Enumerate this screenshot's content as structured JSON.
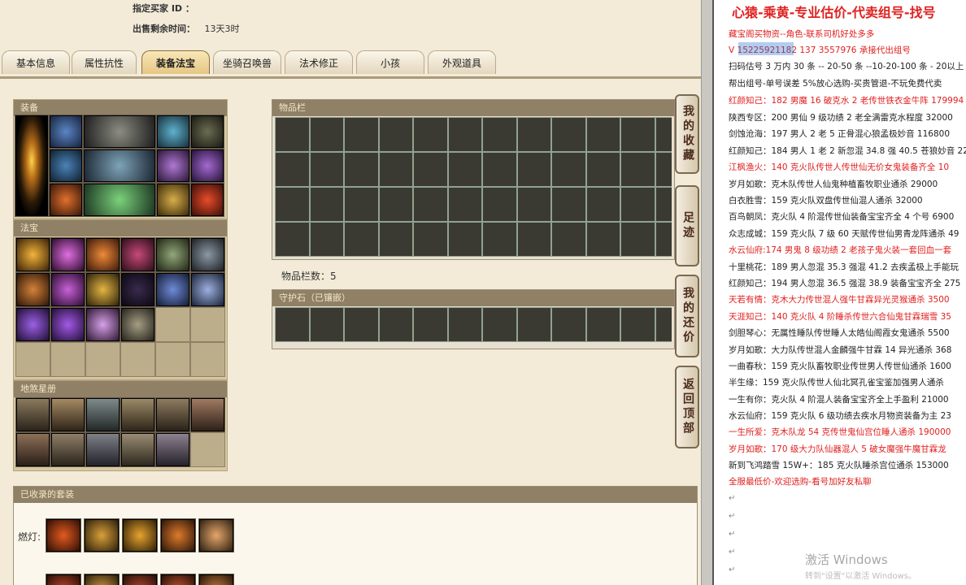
{
  "left_page": {
    "buyer_label": "指定买家 ID ：",
    "time_label": "出售剩余时间：",
    "time_value": "13天3时",
    "tabs": [
      {
        "label": "基本信息",
        "active": false
      },
      {
        "label": "属性抗性",
        "active": false
      },
      {
        "label": "装备法宝",
        "active": true
      },
      {
        "label": "坐骑召唤兽",
        "active": false
      },
      {
        "label": "法术修正",
        "active": false
      },
      {
        "label": "小孩",
        "active": false
      },
      {
        "label": "外观道具",
        "active": false
      }
    ],
    "equip_title": "装备",
    "fabao_title": "法宝",
    "dishagxing_title": "地煞星册",
    "bag_title": "物品栏",
    "bag_count_text": "物品栏数：5",
    "guard_title": "守护石（已镶嵌）",
    "sets_title": "已收录的套装",
    "set_row_label": "燃灯:"
  },
  "side_buttons": [
    "我的收藏",
    "足迹",
    "我的还价",
    "返回顶部"
  ],
  "doc": {
    "title": "心猿-乘黄-专业估价-代卖组号-找号",
    "lines": [
      {
        "text": "藏宝阁买物资--角色-联系司机好处多多",
        "red": true
      },
      {
        "text": "V 15225921182  137 3557976  承接代出组号",
        "red": true
      },
      {
        "text": "扫码估号 3 万内 30 条 -- 20-50 条 --10-20-100 条 - 20以上",
        "red": false
      },
      {
        "text": "帮出组号-单号误差 5%放心选购-买贵管退-不玩免费代卖",
        "red": false
      },
      {
        "text": "红颜知己：182 男魔 16 破克水 2 老传世铁衣金牛阵 179994",
        "red": true
      },
      {
        "text": "陕西专区：200 男仙 9 级功绩 2 老全满雷克水程度 32000",
        "red": false
      },
      {
        "text": "剑蚀沧海：197 男人 2 老 5 正骨混心狼孟极妙音 116800",
        "red": false
      },
      {
        "text": "红颜知己：184 男人 1 老 2 新忽混 34.8 强 40.5 苍狼妙音 22",
        "red": false
      },
      {
        "text": "江枫渔火：140 克火队传世人传世仙无价女鬼装备齐全 10",
        "red": true
      },
      {
        "text": "岁月如歌：克木队传世人仙鬼种植畜牧职业通杀 29000",
        "red": false
      },
      {
        "text": "白衣胜雪：159 克火队双盘传世仙混人通杀 32000",
        "red": false
      },
      {
        "text": "百鸟朝凤：克火队 4 阶混传世仙装备宝宝齐全 4 个号 6900",
        "red": false
      },
      {
        "text": "众志成城：159 克火队 7 级 60 天赋传世仙男青龙阵通杀 49",
        "red": false
      },
      {
        "text": "水云仙府:174 男鬼 8 级功绩 2 老孩子鬼火装一套回血一套",
        "red": true
      },
      {
        "text": "十里桃花：189 男人忽混 35.3 强混 41.2 去疾孟极上手能玩",
        "red": false
      },
      {
        "text": "红颜知己：194 男人忽混 36.5 强混 38.9 装备宝宝齐全 275",
        "red": false
      },
      {
        "text": "天若有情：克木大力传世混人强牛甘霖异光灵猴通杀 3500",
        "red": true
      },
      {
        "text": "天涯知己：140 克火队 4 阶睡杀传世六合仙鬼甘霖瑞雪 35",
        "red": true
      },
      {
        "text": "剑胆琴心：无属性睡队传世睡人太皓仙阁霞女鬼通杀 5500",
        "red": false
      },
      {
        "text": "岁月如歌：大力队传世混人金麟强牛甘霖 14 异光通杀 368",
        "red": false
      },
      {
        "text": "一曲春秋：159 克火队畜牧职业传世男人传世仙通杀 1600",
        "red": false
      },
      {
        "text": "半生缘：159 克火队传世人仙北冥孔雀宝鉴加强男人通杀",
        "red": false
      },
      {
        "text": "一生有你：克火队 4 阶混人装备宝宝齐全上手盈利 21000",
        "red": false
      },
      {
        "text": "水云仙府：159 克火队 6 级功绩去疾水月物资装备为主 23",
        "red": false
      },
      {
        "text": "一生所爱：克木队龙 54 克传世鬼仙宫位睡人通杀 190000",
        "red": true
      },
      {
        "text": "岁月如歌：170 级大力队仙器混人 5 破女魔强牛魔甘霖龙",
        "red": true
      },
      {
        "text": "新到飞鸿踏雪 15W+：185 克火队睡杀宫位通杀 153000",
        "red": false
      },
      {
        "text": "全服最低价-欢迎选购-看号加好友私聊",
        "red": true
      }
    ],
    "watermark_1": "激活 Windows",
    "watermark_2": "转到\"设置\"以激活 Windows。"
  }
}
